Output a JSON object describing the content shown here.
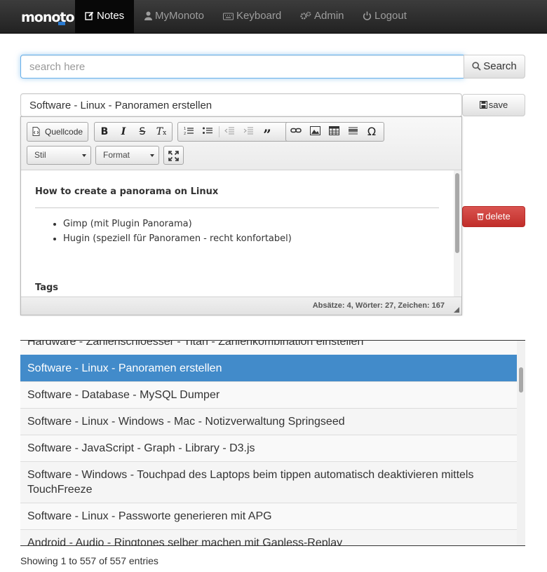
{
  "app": {
    "logo_text": "monoto"
  },
  "nav": {
    "notes": "Notes",
    "mymonoto": "MyMonoto",
    "keyboard": "Keyboard",
    "admin": "Admin",
    "logout": "Logout"
  },
  "search": {
    "placeholder": "search here",
    "button": "Search"
  },
  "note": {
    "title_value": "Software - Linux - Panoramen erstellen",
    "save": "save",
    "delete": "delete"
  },
  "editor": {
    "source": "Quellcode",
    "style_combo": "Stil",
    "format_combo": "Format",
    "heading": "How to create a panorama on Linux",
    "bullets": [
      "Gimp (mit Plugin Panorama)",
      "Hugin (speziell für Panoramen - recht konfortabel)"
    ],
    "tags_heading": "Tags",
    "status": "Absätze: 4, Wörter: 27, Zeichen: 167"
  },
  "notes_list": [
    "Hardware - Zahlenschloesser - Titan - Zahlenkombination einstellen",
    "Software - Linux - Panoramen erstellen",
    "Software - Database - MySQL Dumper",
    "Software - Linux - Windows - Mac - Notizverwaltung Springseed",
    "Software - JavaScript - Graph - Library - D3.js",
    "Software - Windows - Touchpad des Laptops beim tippen automatisch deaktivieren mittels TouchFreeze",
    "Software - Linux - Passworte generieren mit APG",
    "Android - Audio - Ringtones selber machen mit Gapless-Replay"
  ],
  "table_info": "Showing 1 to 557 of 557 entries",
  "colors": {
    "accent": "#428bca",
    "danger": "#d9534f",
    "navbar": "#222222"
  }
}
